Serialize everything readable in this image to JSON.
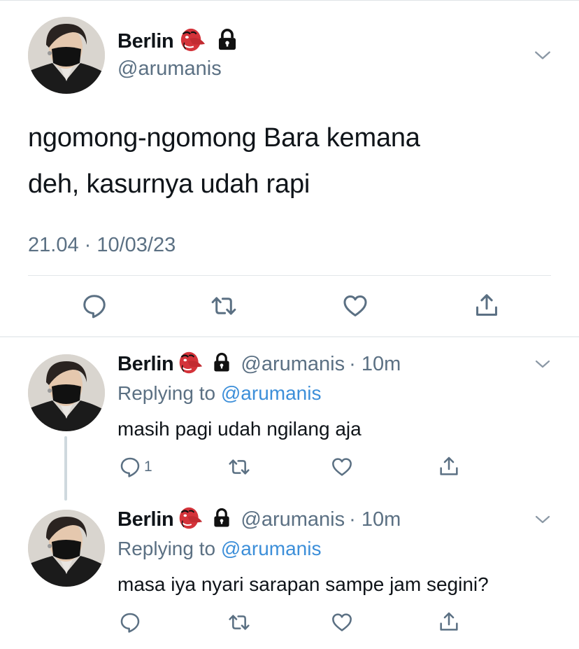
{
  "main_tweet": {
    "name": "Berlin",
    "handle": "@arumanis",
    "text_line1": "ngomong-ngomong Bara kemana",
    "text_line2": "deh, kasurnya udah rapi",
    "timestamp": "21.04 · 10/03/23"
  },
  "replies": [
    {
      "name": "Berlin",
      "handle": "@arumanis",
      "time": "· 10m",
      "replying_prefix": "Replying to",
      "replying_handle": "@arumanis",
      "text": "masih pagi udah ngilang aja",
      "reply_count": "1"
    },
    {
      "name": "Berlin",
      "handle": "@arumanis",
      "time": "· 10m",
      "replying_prefix": "Replying to",
      "replying_handle": "@arumanis",
      "text": "masa iya nyari sarapan sampe jam segini?",
      "reply_count": ""
    }
  ],
  "icons": {
    "badge": "tengu-mask-emoji",
    "lock": "lock-icon",
    "menu": "chevron-down-icon",
    "actions": [
      "reply-icon",
      "retweet-icon",
      "like-icon",
      "share-icon"
    ]
  },
  "colors": {
    "link": "#3d8fd9",
    "secondary": "#5b7083",
    "badge_red": "#d4333a"
  }
}
